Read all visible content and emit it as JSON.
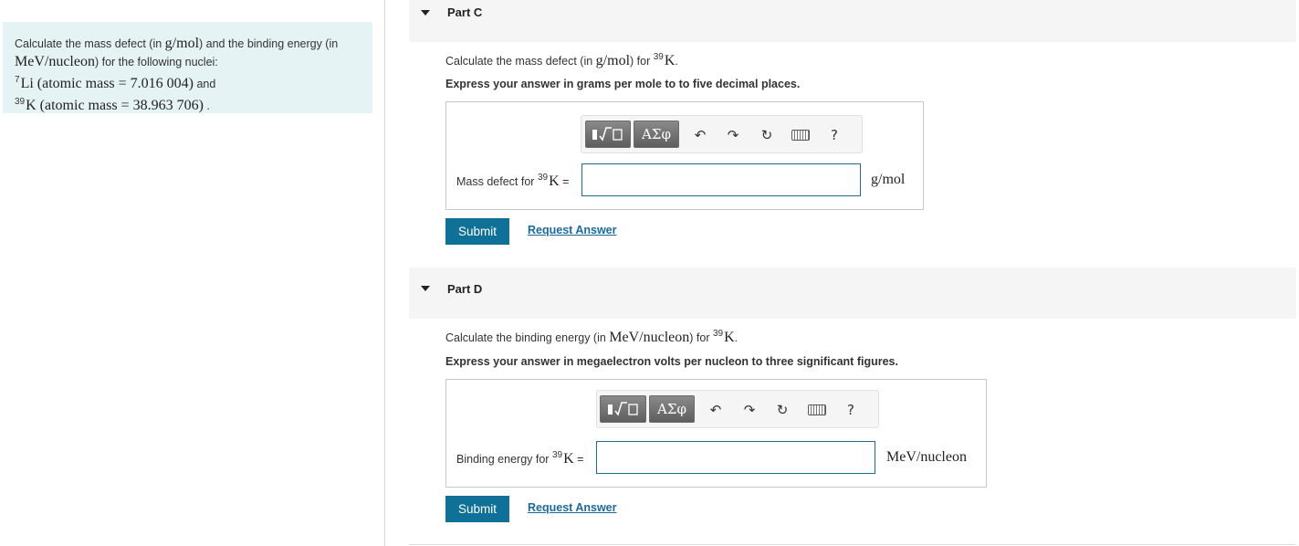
{
  "problem": {
    "intro_a": "Calculate the mass defect (in ",
    "unit_gmol": "g/mol",
    "intro_b": ") and the binding energy (in",
    "unit_mev": "MeV/nucleon",
    "intro_c": ") for the following nuclei:",
    "li_mass_num": "7",
    "li_text": "Li (atomic mass = 7.016 004)",
    "and": " and",
    "k_mass_num": "39",
    "k_text": "K (atomic mass = 38.963 706)",
    "period": " ."
  },
  "part_c": {
    "title": "Part C",
    "prompt_a": "Calculate the mass defect (in ",
    "prompt_unit": "g/mol",
    "prompt_b": ") for ",
    "mass_num": "39",
    "element": "K",
    "dot": ".",
    "instruction": "Express your answer in grams per mole to to five decimal places.",
    "label_a": "Mass defect for ",
    "label_eq": " =",
    "input_value": "",
    "unit": "g/mol",
    "submit": "Submit",
    "request": "Request Answer"
  },
  "part_d": {
    "title": "Part D",
    "prompt_a": "Calculate the binding energy (in ",
    "prompt_unit": "MeV/nucleon",
    "prompt_b": ") for ",
    "mass_num": "39",
    "element": "K",
    "dot": ".",
    "instruction": "Express your answer in megaelectron volts per nucleon to three significant figures.",
    "label_a": "Binding energy for ",
    "label_eq": " =",
    "input_value": "",
    "unit": "MeV/nucleon",
    "submit": "Submit",
    "request": "Request Answer"
  },
  "toolbar": {
    "symbols_label": "ΑΣφ",
    "help": "?",
    "icons": [
      "templates-icon",
      "symbols-icon",
      "undo-icon",
      "redo-icon",
      "reset-icon",
      "keyboard-icon",
      "help-icon"
    ]
  },
  "colors": {
    "accent": "#0f7197",
    "problem_bg": "#e6f3f5",
    "header_bg": "#f5f5f5"
  }
}
